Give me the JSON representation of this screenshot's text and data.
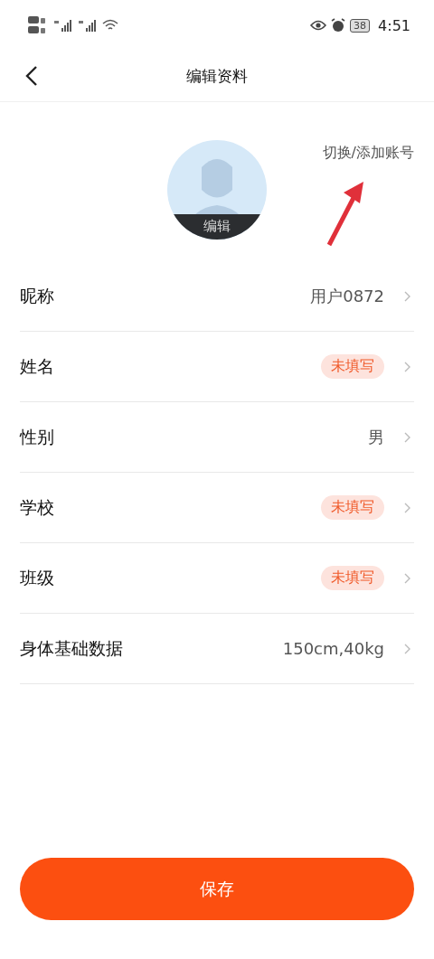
{
  "status_bar": {
    "battery": "38",
    "time": "4:51"
  },
  "header": {
    "title": "编辑资料"
  },
  "profile": {
    "avatar_label": "编辑",
    "switch_account": "切换/添加账号"
  },
  "rows": [
    {
      "label": "昵称",
      "kind": "value",
      "value": "用户0872"
    },
    {
      "label": "姓名",
      "kind": "empty",
      "value": "未填写"
    },
    {
      "label": "性别",
      "kind": "value",
      "value": "男"
    },
    {
      "label": "学校",
      "kind": "empty",
      "value": "未填写"
    },
    {
      "label": "班级",
      "kind": "empty",
      "value": "未填写"
    },
    {
      "label": "身体基础数据",
      "kind": "value",
      "value": "150cm,40kg"
    }
  ],
  "save_button": "保存"
}
